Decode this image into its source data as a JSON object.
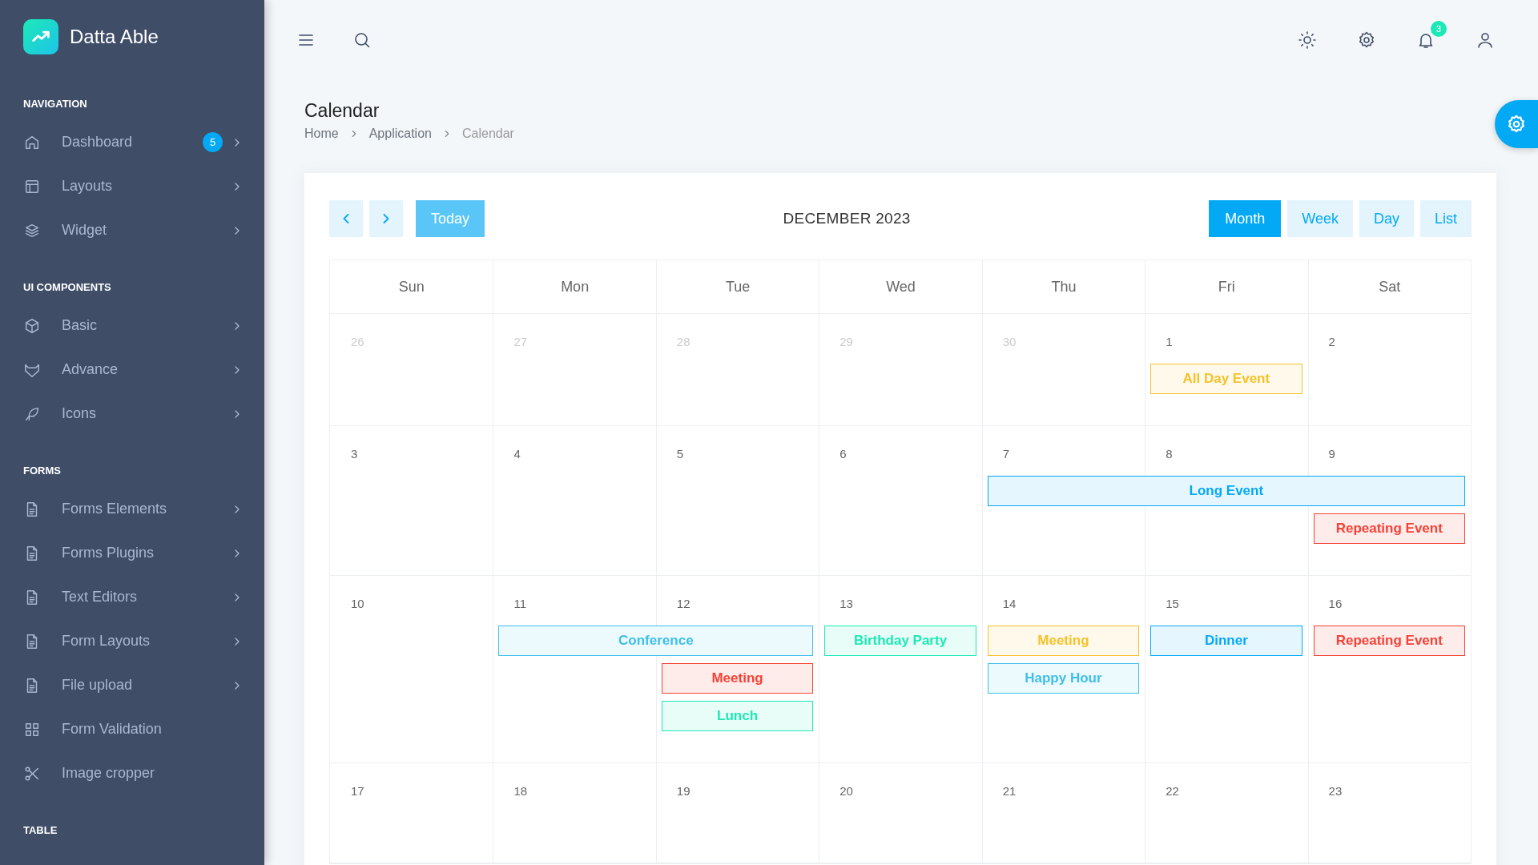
{
  "brand": {
    "name": "Datta Able"
  },
  "sidebar": {
    "sections": [
      {
        "title": "NAVIGATION",
        "items": [
          {
            "label": "Dashboard",
            "badge": "5",
            "has_arrow": true
          },
          {
            "label": "Layouts",
            "has_arrow": true
          },
          {
            "label": "Widget",
            "has_arrow": true
          }
        ]
      },
      {
        "title": "UI COMPONENTS",
        "items": [
          {
            "label": "Basic",
            "has_arrow": true
          },
          {
            "label": "Advance",
            "has_arrow": true
          },
          {
            "label": "Icons",
            "has_arrow": true
          }
        ]
      },
      {
        "title": "FORMS",
        "items": [
          {
            "label": "Forms Elements",
            "has_arrow": true
          },
          {
            "label": "Forms Plugins",
            "has_arrow": true
          },
          {
            "label": "Text Editors",
            "has_arrow": true
          },
          {
            "label": "Form Layouts",
            "has_arrow": true
          },
          {
            "label": "File upload",
            "has_arrow": true
          },
          {
            "label": "Form Validation",
            "has_arrow": false
          },
          {
            "label": "Image cropper",
            "has_arrow": false
          }
        ]
      },
      {
        "title": "TABLE"
      }
    ]
  },
  "topbar": {
    "notification_count": "3"
  },
  "page": {
    "title": "Calendar",
    "breadcrumb": [
      {
        "label": "Home"
      },
      {
        "label": "Application"
      },
      {
        "label": "Calendar"
      }
    ]
  },
  "calendar": {
    "today_label": "Today",
    "title": "DECEMBER 2023",
    "views": [
      {
        "label": "Month",
        "selected": true
      },
      {
        "label": "Week",
        "selected": false
      },
      {
        "label": "Day",
        "selected": false
      },
      {
        "label": "List",
        "selected": false
      }
    ],
    "weekdays": [
      "Sun",
      "Mon",
      "Tue",
      "Wed",
      "Thu",
      "Fri",
      "Sat"
    ],
    "weeks": [
      {
        "days": [
          {
            "date": "26",
            "muted": true
          },
          {
            "date": "27",
            "muted": true
          },
          {
            "date": "28",
            "muted": true
          },
          {
            "date": "29",
            "muted": true
          },
          {
            "date": "30",
            "muted": true
          },
          {
            "date": "1",
            "muted": false,
            "events": [
              {
                "title": "All Day Event",
                "kind": "one-day",
                "color": "#f4c22b"
              }
            ]
          },
          {
            "date": "2",
            "muted": false
          }
        ]
      },
      {
        "days": [
          {
            "date": "3",
            "muted": false
          },
          {
            "date": "4",
            "muted": false
          },
          {
            "date": "5",
            "muted": false
          },
          {
            "date": "6",
            "muted": false
          },
          {
            "date": "7",
            "muted": false,
            "events": [
              {
                "title": "Long Event",
                "kind": "three-day",
                "color": "#04a9f5"
              }
            ]
          },
          {
            "date": "8",
            "muted": false
          },
          {
            "date": "9",
            "muted": false,
            "events": [
              {
                "title": "Repeating Event",
                "kind": "one-day",
                "color": "#f44236"
              }
            ]
          }
        ]
      },
      {
        "days": [
          {
            "date": "10",
            "muted": false
          },
          {
            "date": "11",
            "muted": false,
            "events": [
              {
                "title": "Conference",
                "kind": "two-day",
                "color": "#3ebfea"
              }
            ]
          },
          {
            "date": "12",
            "muted": false,
            "events": [
              {
                "title": "Meeting",
                "kind": "one-day",
                "color": "#f44236"
              },
              {
                "title": "Lunch",
                "kind": "one-day",
                "color": "#1de9b6"
              }
            ]
          },
          {
            "date": "13",
            "muted": false,
            "events": [
              {
                "title": "Birthday Party",
                "kind": "one-day",
                "color": "#1de9b6"
              }
            ]
          },
          {
            "date": "14",
            "muted": false,
            "events": [
              {
                "title": "Meeting",
                "kind": "one-day",
                "color": "#f4c22b"
              },
              {
                "title": "Happy Hour",
                "kind": "one-day",
                "color": "#3ebfea"
              }
            ]
          },
          {
            "date": "15",
            "muted": false,
            "events": [
              {
                "title": "Dinner",
                "kind": "one-day",
                "color": "#04a9f5"
              }
            ]
          },
          {
            "date": "16",
            "muted": false,
            "events": [
              {
                "title": "Repeating Event",
                "kind": "one-day",
                "color": "#f44236"
              }
            ]
          }
        ]
      },
      {
        "days": [
          {
            "date": "17",
            "muted": false
          },
          {
            "date": "18",
            "muted": false
          },
          {
            "date": "19",
            "muted": false
          },
          {
            "date": "20",
            "muted": false
          },
          {
            "date": "21",
            "muted": false
          },
          {
            "date": "22",
            "muted": false
          },
          {
            "date": "23",
            "muted": false
          }
        ]
      }
    ]
  }
}
